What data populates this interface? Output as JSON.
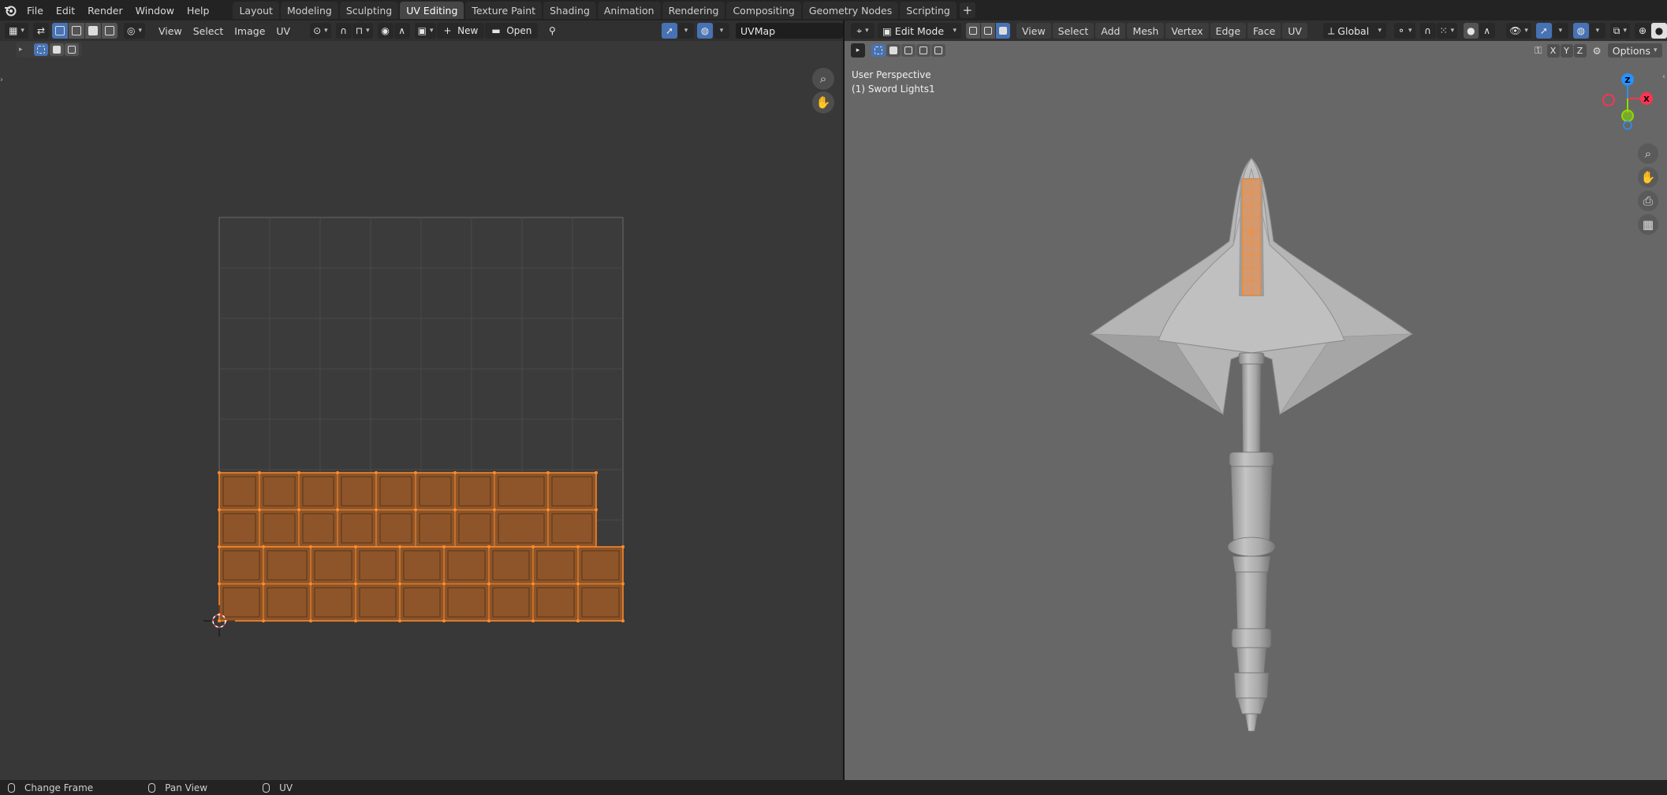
{
  "menubar": {
    "items": [
      "File",
      "Edit",
      "Render",
      "Window",
      "Help"
    ]
  },
  "workspace_tabs": [
    {
      "label": "Layout",
      "active": false
    },
    {
      "label": "Modeling",
      "active": false
    },
    {
      "label": "Sculpting",
      "active": false
    },
    {
      "label": "UV Editing",
      "active": true
    },
    {
      "label": "Texture Paint",
      "active": false
    },
    {
      "label": "Shading",
      "active": false
    },
    {
      "label": "Animation",
      "active": false
    },
    {
      "label": "Rendering",
      "active": false
    },
    {
      "label": "Compositing",
      "active": false
    },
    {
      "label": "Geometry Nodes",
      "active": false
    },
    {
      "label": "Scripting",
      "active": false
    }
  ],
  "uv_editor": {
    "menus": [
      "View",
      "Select",
      "Image",
      "UV"
    ],
    "new_label": "New",
    "open_label": "Open",
    "uvmap_field": "UVMap"
  },
  "viewport": {
    "mode": "Edit Mode",
    "menus": [
      "View",
      "Select",
      "Add",
      "Mesh",
      "Vertex",
      "Edge",
      "Face",
      "UV"
    ],
    "transform_orientation": "Global",
    "options_label": "Options",
    "perspective_label": "User Perspective",
    "object_label": "(1) Sword Lights1",
    "axis_toggles": [
      "X",
      "Y",
      "Z"
    ],
    "gizmo_axes": {
      "z": "Z",
      "x": "X"
    },
    "axis_colors": {
      "x": "#ff3352",
      "y": "#8bdc00",
      "z": "#2890ff"
    }
  },
  "statusbar": {
    "items": [
      "Change Frame",
      "Pan View",
      "UV"
    ]
  },
  "colors": {
    "active_blue": "#4772b3",
    "uv_selection": "#ff8a2a",
    "uv_face_fill": "#9a5a2c"
  },
  "icons": [
    "blender-logo-icon",
    "editor-type-icon",
    "sync-selection-icon",
    "pivot-icon",
    "snap-icon",
    "proportional-icon",
    "pin-icon",
    "zoom-icon",
    "hand-icon",
    "camera-icon",
    "grid-view-icon",
    "overlay-icon",
    "shading-icon"
  ]
}
